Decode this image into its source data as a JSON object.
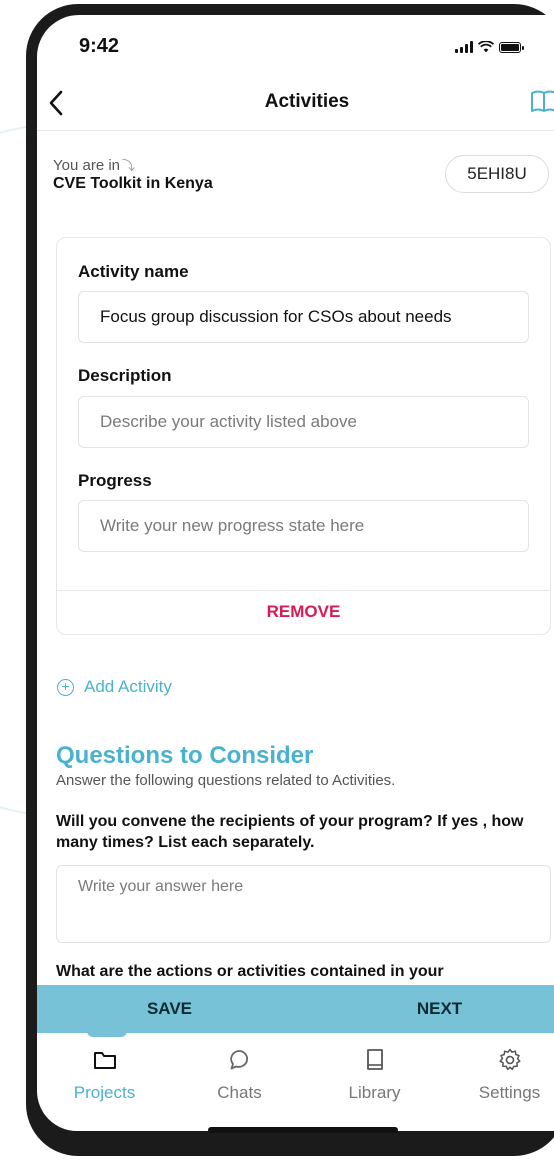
{
  "status": {
    "time": "9:42"
  },
  "nav": {
    "title": "Activities"
  },
  "project": {
    "label": "You are in",
    "name": "CVE Toolkit in Kenya",
    "code": "5EHI8U"
  },
  "activity": {
    "name_label": "Activity name",
    "name_value": "Focus group discussion for CSOs about needs",
    "description_label": "Description",
    "description_placeholder": "Describe your activity listed above",
    "progress_label": "Progress",
    "progress_placeholder": "Write your new progress state here",
    "remove_label": "REMOVE"
  },
  "add_activity_label": "Add Activity",
  "questions": {
    "title": "Questions to Consider",
    "subtitle": "Answer the following questions related to Activities.",
    "items": [
      {
        "text": "Will you convene the recipients of your program? If yes , how many times? List each separately.",
        "placeholder": "Write your answer here"
      },
      {
        "text": "What are the actions or activities contained in your"
      }
    ]
  },
  "actions": {
    "save": "SAVE",
    "next": "NEXT"
  },
  "tabs": [
    {
      "label": "Projects",
      "icon": "folder-icon",
      "active": true
    },
    {
      "label": "Chats",
      "icon": "chat-bubble-icon",
      "active": false
    },
    {
      "label": "Library",
      "icon": "book-icon",
      "active": false
    },
    {
      "label": "Settings",
      "icon": "gear-icon",
      "active": false
    }
  ],
  "colors": {
    "accent": "#49b3cf",
    "action_bar": "#77c2d6",
    "danger": "#d81b55"
  }
}
